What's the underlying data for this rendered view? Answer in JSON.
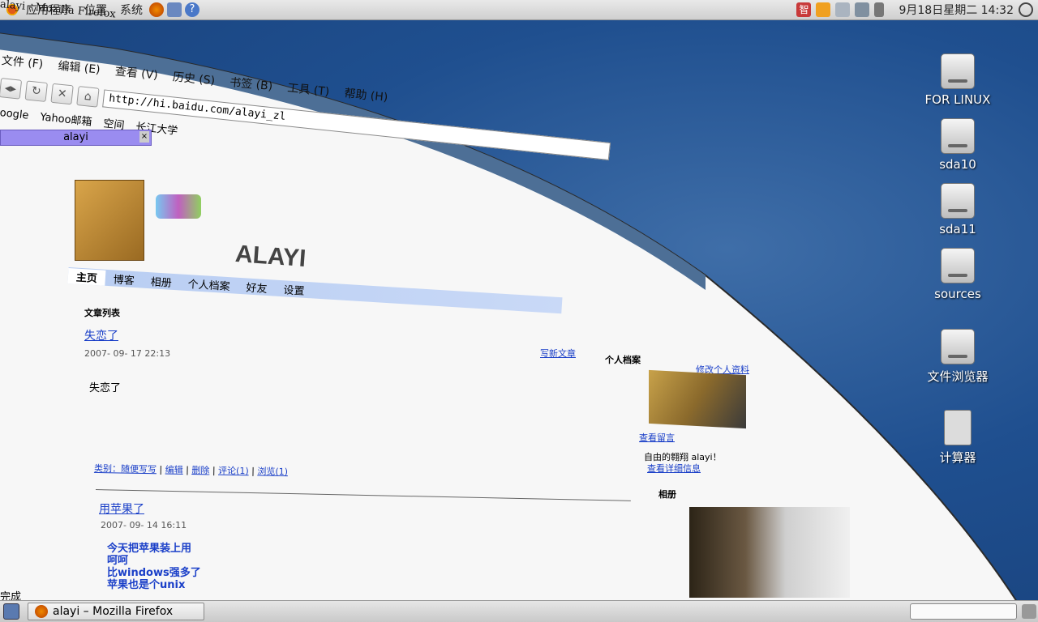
{
  "panel": {
    "menus": [
      "应用程序",
      "位置",
      "系统"
    ],
    "clock": "9月18日星期二 14:32",
    "tray_icons": [
      "input-method-icon",
      "notification-icon",
      "network-icon",
      "display-icon",
      "volume-icon",
      "power-icon"
    ]
  },
  "desktop_icons": [
    {
      "label": "FOR LINUX",
      "icon": "drive-icon"
    },
    {
      "label": "sda10",
      "icon": "drive-icon"
    },
    {
      "label": "sda11",
      "icon": "drive-icon"
    },
    {
      "label": "sources",
      "icon": "drive-icon"
    },
    {
      "label": "文件浏览器",
      "icon": "drive-icon"
    },
    {
      "label": "计算器",
      "icon": "calculator-icon"
    }
  ],
  "firefox": {
    "title": "alayi - Mozilla Firefox",
    "menu": [
      "文件 (F)",
      "编辑 (E)",
      "查看 (V)",
      "历史 (S)",
      "书签 (B)",
      "工具 (T)",
      "帮助 (H)"
    ],
    "url": "http://hi.baidu.com/alayi_zl",
    "bookmarks": [
      "oogle",
      "Yahoo邮箱",
      "空间",
      "长江大学"
    ],
    "tab": "alayi",
    "status": "完成"
  },
  "blog": {
    "logo_text": "ALAYI",
    "nav": [
      "主页",
      "博客",
      "相册",
      "个人档案",
      "好友",
      "设置"
    ],
    "section_title": "文章列表",
    "posts": [
      {
        "title": "失恋了",
        "date": "2007- 09- 17 22:13",
        "body": "失恋了",
        "meta": [
          "类别：随便写写",
          "编辑",
          "删除",
          "评论(1)",
          "浏览(1)"
        ]
      },
      {
        "title": "用苹果了",
        "date": "2007- 09- 14 16:11",
        "body": [
          "今天把苹果装上用",
          "呵呵",
          "比windows强多了",
          "苹果也是个unix"
        ]
      }
    ],
    "write_link": "写新文章",
    "sidebar": {
      "profile_title": "个人档案",
      "edit_profile": "修改个人资料",
      "view_message": "查看留言",
      "motto": "自由的翱翔 alayi！",
      "view_detail": "查看详细信息",
      "album_title": "相册"
    }
  },
  "taskbar": {
    "window_label": "alayi – Mozilla Firefox"
  },
  "colors": {
    "desktop": "#1f4f8f",
    "tab_bg": "#9a8cf0",
    "nav_bg": "#c9d9f7",
    "link": "#1a3fc8"
  }
}
